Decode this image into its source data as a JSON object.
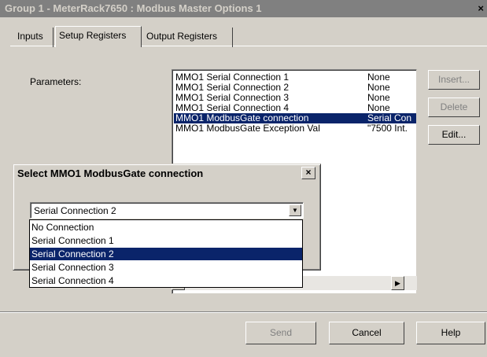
{
  "window": {
    "title": "Group 1 - MeterRack7650 : Modbus Master Options 1",
    "close": "×"
  },
  "tabs": [
    "Inputs",
    "Setup Registers",
    "Output Registers"
  ],
  "parameters_label": "Parameters:",
  "registers": [
    {
      "name": "MMO1 Serial Connection 1",
      "value": "None"
    },
    {
      "name": "MMO1 Serial Connection 2",
      "value": "None"
    },
    {
      "name": "MMO1 Serial Connection 3",
      "value": "None"
    },
    {
      "name": "MMO1 Serial Connection 4",
      "value": "None"
    },
    {
      "name": "MMO1 ModbusGate connection",
      "value": "Serial Con"
    },
    {
      "name": "MMO1 ModbusGate Exception Val",
      "value": "\"7500 Int."
    }
  ],
  "selected_register_index": 4,
  "side_buttons": {
    "insert": "Insert...",
    "delete": "Delete",
    "edit": "Edit..."
  },
  "bottom_buttons": {
    "send": "Send",
    "cancel": "Cancel",
    "help": "Help"
  },
  "dialog": {
    "title": "Select MMO1 ModbusGate connection",
    "close": "×",
    "selected_value": "Serial Connection 2",
    "options": [
      "No Connection",
      "Serial Connection 1",
      "Serial Connection 2",
      "Serial Connection 3",
      "Serial Connection 4"
    ],
    "highlighted_option_index": 2
  },
  "colors": {
    "selection": "#0a246a",
    "face": "#d4d0c8",
    "titlebar_inactive": "#808080"
  },
  "icons": {
    "combo_arrow": "▼",
    "scroll_right": "▶",
    "scroll_left": "◀"
  }
}
